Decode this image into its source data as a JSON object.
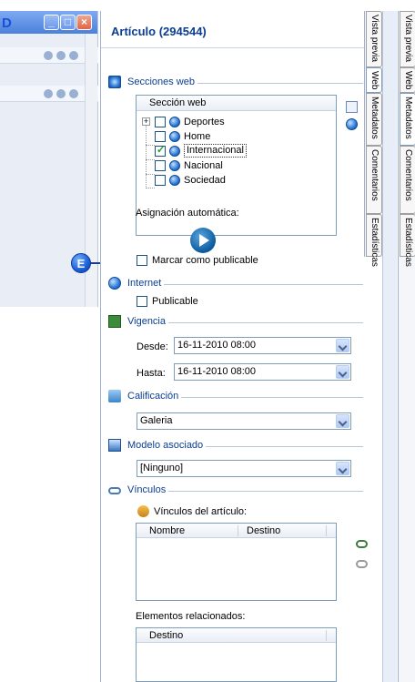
{
  "background_window": {
    "letter": "D",
    "close_glyph": "×",
    "max_glyph": "□",
    "min_glyph": "_"
  },
  "callout": {
    "letter": "E"
  },
  "panel": {
    "title": "Artículo (294544)"
  },
  "sections": {
    "web": {
      "label": "Secciones web",
      "tree_header": "Sección web",
      "items": [
        {
          "label": "Deportes",
          "checked": false
        },
        {
          "label": "Home",
          "checked": false
        },
        {
          "label": "Internacional",
          "checked": true,
          "selected": true
        },
        {
          "label": "Nacional",
          "checked": false
        },
        {
          "label": "Sociedad",
          "checked": false
        }
      ],
      "auto_label": "Asignación automática:",
      "publishable_label": "Marcar como publicable"
    },
    "internet": {
      "label": "Internet",
      "publicable_label": "Publicable"
    },
    "vigencia": {
      "label": "Vigencia",
      "desde_label": "Desde:",
      "desde_value": "16-11-2010 08:00",
      "hasta_label": "Hasta:",
      "hasta_value": "16-11-2010 08:00"
    },
    "calificacion": {
      "label": "Calificación",
      "value": "Galeria"
    },
    "modelo": {
      "label": "Modelo asociado",
      "value": "[Ninguno]"
    },
    "vinculos": {
      "label": "Vínculos",
      "articulo_label": "Vínculos del artículo:",
      "col_nombre": "Nombre",
      "col_destino": "Destino",
      "relacionados_label": "Elementos relacionados:",
      "rel_col_destino": "Destino"
    }
  },
  "tabs_inner": [
    "Vista previa",
    "Web",
    "Metadatos",
    "Comentarios",
    "Estadísticas"
  ],
  "tabs_outer": [
    "Vista previa",
    "Web",
    "Metadatos",
    "Comentarios",
    "Estadísticas"
  ]
}
